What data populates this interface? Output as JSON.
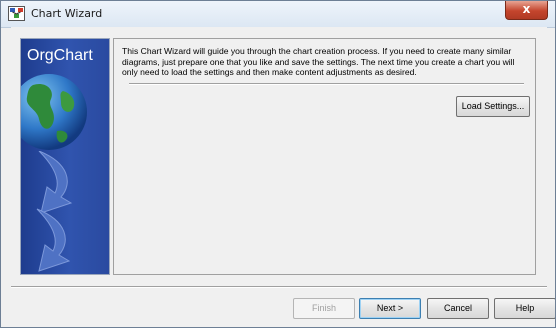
{
  "window": {
    "title": "Chart Wizard",
    "close_label": "x"
  },
  "side_panel": {
    "brand": "OrgChart"
  },
  "content": {
    "intro": "This Chart Wizard will guide you through the chart creation process. If you need to create many similar diagrams, just prepare one that you like and save the settings. The next time you create a chart you will only need to load the settings and then make content adjustments as desired.",
    "load_settings_label": "Load Settings..."
  },
  "footer": {
    "finish_label": "Finish",
    "finish_enabled": false,
    "next_label": "Next >",
    "cancel_label": "Cancel",
    "help_label": "Help"
  },
  "colors": {
    "side_panel_blue": "#2a4aa0",
    "close_button_red": "#c4452d",
    "default_button_focus": "#3c7fb1"
  }
}
